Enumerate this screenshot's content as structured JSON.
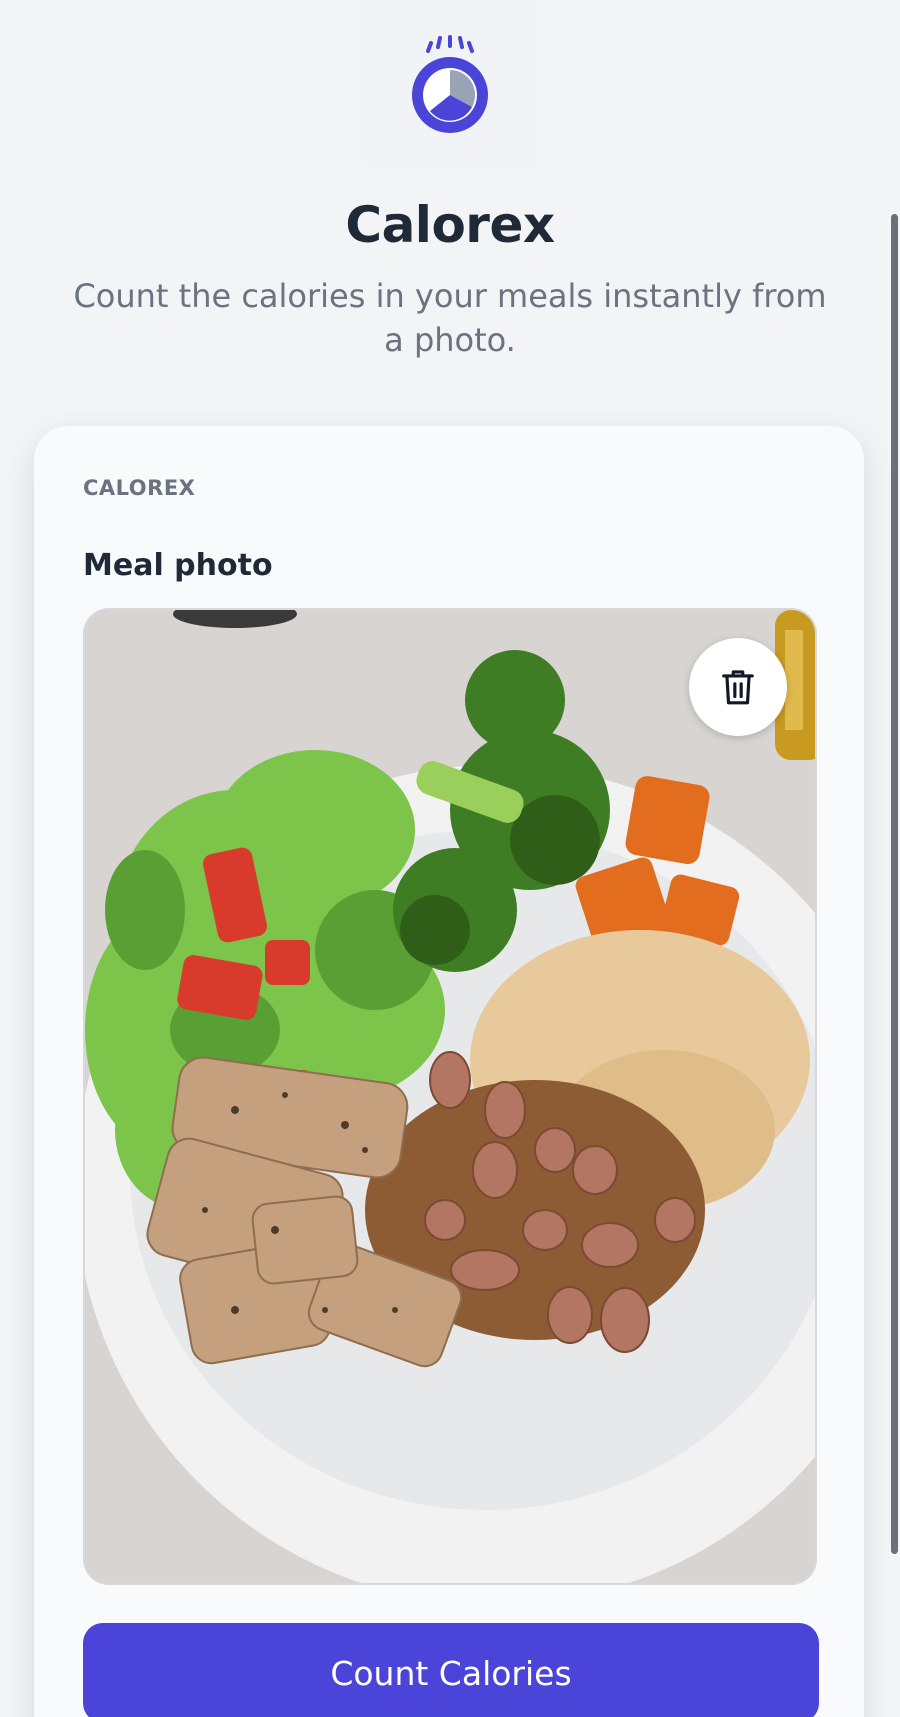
{
  "app": {
    "logo_icon": "calorex-logo-icon",
    "title": "Calorex",
    "subtitle": "Count the calories in your meals instantly from a photo."
  },
  "card": {
    "eyebrow": "CALOREX",
    "field_label": "Meal photo",
    "photo": {
      "alt": "Meal photo",
      "delete_icon": "trash-icon"
    },
    "submit_label": "Count Calories"
  },
  "colors": {
    "accent": "#4a44d8",
    "title": "#1f2937",
    "muted": "#6b7280",
    "background": "#f3f4f6"
  }
}
